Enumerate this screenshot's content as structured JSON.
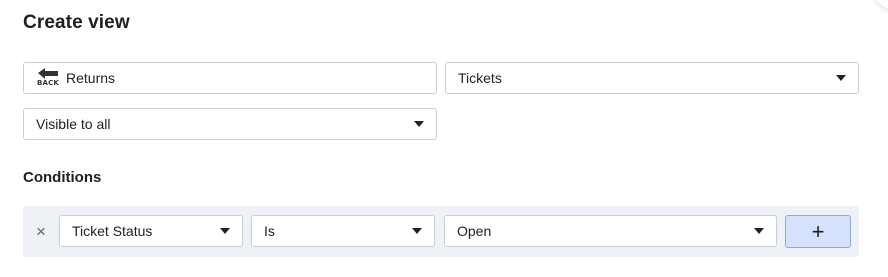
{
  "title": "Create view",
  "name_field": {
    "icon": "back-icon",
    "icon_label": "BACK",
    "value": "Returns"
  },
  "type_select": {
    "value": "Tickets"
  },
  "visibility_select": {
    "value": "Visible to all"
  },
  "conditions": {
    "label": "Conditions",
    "rows": [
      {
        "remove_icon": "×",
        "field": "Ticket Status",
        "operator": "Is",
        "value": "Open"
      }
    ],
    "add_label": "+"
  }
}
